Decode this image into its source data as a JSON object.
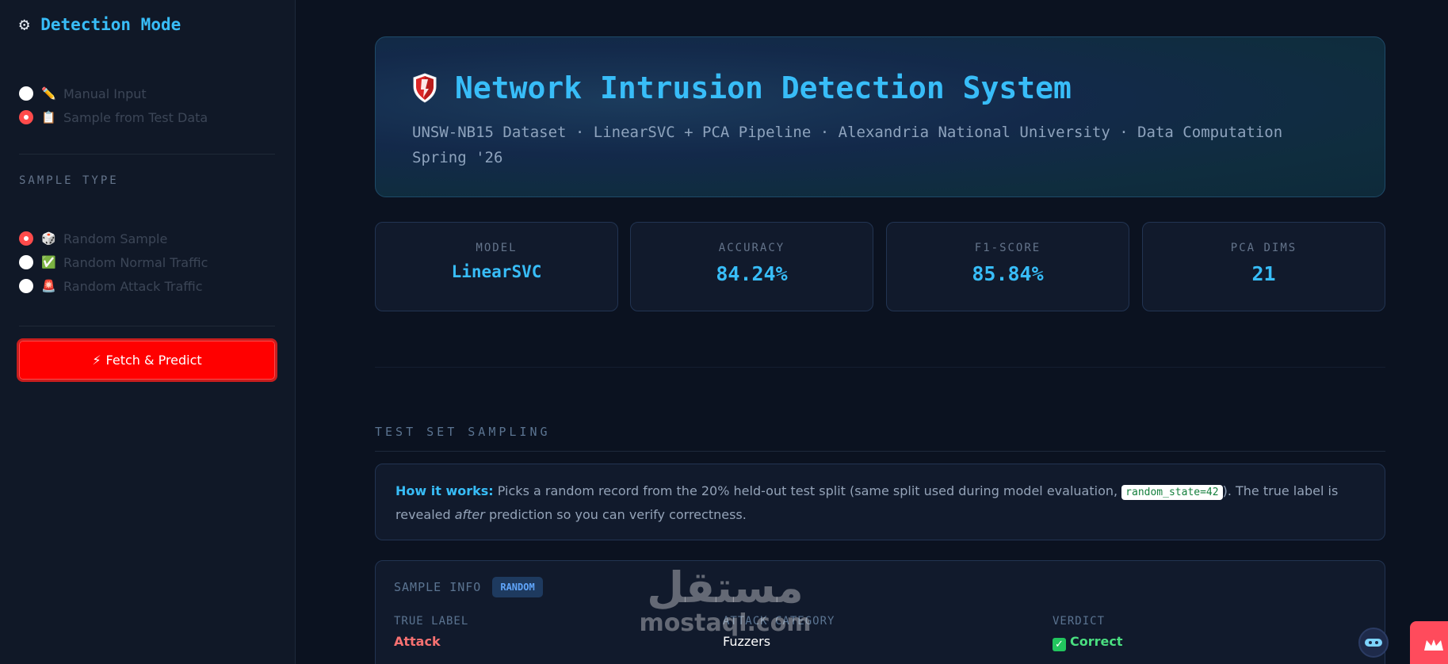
{
  "sidebar": {
    "title": "Detection Mode",
    "title_icon": "gear-icon",
    "modes": [
      {
        "label": "Manual Input",
        "icon": "✏️",
        "selected": false
      },
      {
        "label": "Sample from Test Data",
        "icon": "📋",
        "selected": true
      }
    ],
    "sample_type_label": "SAMPLE TYPE",
    "sample_types": [
      {
        "label": "Random Sample",
        "icon": "🎲",
        "selected": true
      },
      {
        "label": "Random Normal Traffic",
        "icon": "✅",
        "selected": false
      },
      {
        "label": "Random Attack Traffic",
        "icon": "🚨",
        "selected": false
      }
    ],
    "fetch_button": {
      "icon": "⚡",
      "label": "Fetch & Predict"
    }
  },
  "hero": {
    "title": "Network Intrusion Detection System",
    "subtitle": "UNSW-NB15 Dataset  ·  LinearSVC + PCA Pipeline  ·  Alexandria National University  ·  Data Computation Spring '26"
  },
  "stats": [
    {
      "label": "MODEL",
      "value": "LinearSVC"
    },
    {
      "label": "ACCURACY",
      "value": "84.24%"
    },
    {
      "label": "F1-SCORE",
      "value": "85.84%"
    },
    {
      "label": "PCA DIMS",
      "value": "21"
    }
  ],
  "section": {
    "title": "TEST SET SAMPLING"
  },
  "info": {
    "lead": "How it works:",
    "text1": " Picks a random record from the 20% held-out test split (same split used during model evaluation, ",
    "code": "random_state=42",
    "text2": "). The true label is revealed ",
    "emph": "after",
    "text3": " prediction so you can verify correctness."
  },
  "sample_info": {
    "title": "SAMPLE INFO",
    "badge": "RANDOM",
    "true_label": {
      "label": "TRUE LABEL",
      "value": "Attack"
    },
    "attack_category": {
      "label": "ATTACK CATEGORY",
      "value": "Fuzzers"
    },
    "verdict": {
      "label": "VERDICT",
      "value": "Correct"
    }
  },
  "watermark": {
    "arabic": "مستقل",
    "latin": "mostaql.com"
  },
  "colors": {
    "accent": "#38bdf8",
    "danger": "#ff0000",
    "success": "#4ade80"
  }
}
